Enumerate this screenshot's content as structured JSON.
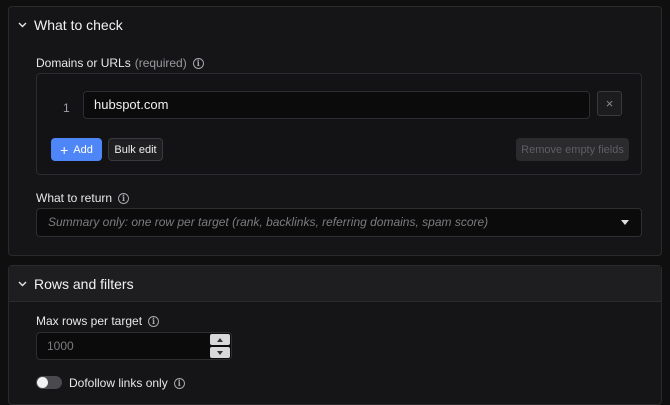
{
  "what_to_check": {
    "title": "What to check",
    "domains_label": "Domains or URLs",
    "domains_required": "(required)",
    "rows": [
      {
        "index": "1",
        "value": "hubspot.com"
      }
    ],
    "delete_icon": "×",
    "add_label": "Add",
    "bulk_edit_label": "Bulk edit",
    "remove_empty_label": "Remove empty fields",
    "return_label": "What to return",
    "return_value": "Summary only: one row per target (rank, backlinks, referring domains, spam score)"
  },
  "rows_and_filters": {
    "title": "Rows and filters",
    "max_rows_label": "Max rows per target",
    "max_rows_placeholder": "1000",
    "dofollow_label": "Dofollow links only",
    "dofollow_on": false
  },
  "colors": {
    "accent": "#4f86f7",
    "background": "#0f0f10",
    "panel": "#151517"
  }
}
